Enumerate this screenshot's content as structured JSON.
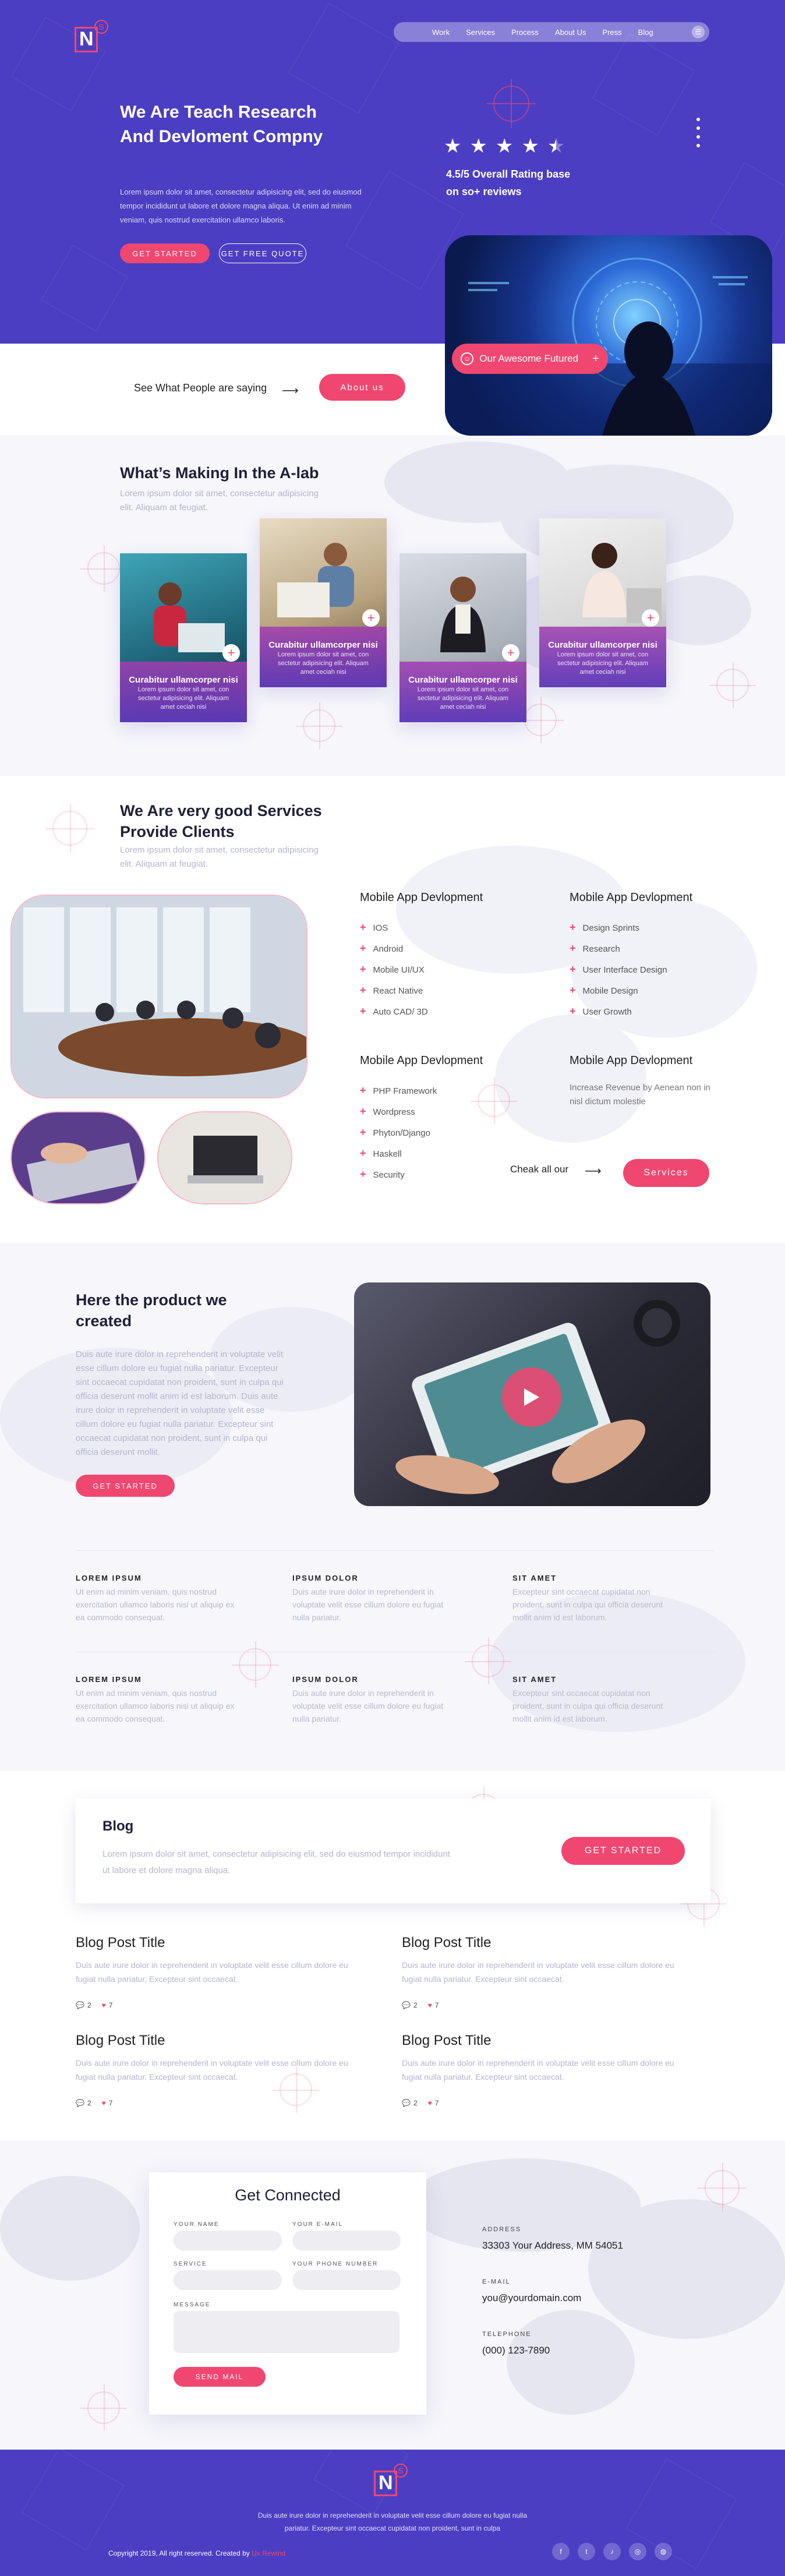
{
  "colors": {
    "brand": "#4b3ec2",
    "accent": "#f04770",
    "muted": "#b3b6cc",
    "section_bg": "#f6f6fb"
  },
  "header": {
    "logo_letter": "N",
    "logo_badge": "S",
    "nav": [
      "Work",
      "Services",
      "Process",
      "About Us",
      "Press",
      "Blog"
    ],
    "menu_icon": "menu-icon"
  },
  "hero": {
    "title": "We Are Teach Research And Devloment Compny",
    "description": "Lorem ipsum dolor sit amet, consectetur adipisicing elit, sed do eiusmod tempor incididunt ut labore et dolore magna aliqua. Ut enim ad minim veniam, quis nostrud exercitation ullamco laboris.",
    "cta_label": "Get Started",
    "quote_label": "Get Free Quote",
    "rating": 4.5,
    "rating_max": 5,
    "rating_text": "4.5/5 Overall Rating base on so+ reviews",
    "featured_label": "Our Awesome Futured",
    "featured_icon": "smile-icon"
  },
  "testimonial": {
    "text": "See What People are saying",
    "button": "About us"
  },
  "lab": {
    "title": "What’s Making In the A-lab",
    "description": "Lorem ipsum dolor sit amet, consectetur adipisicing elit. Aliquam at feugiat.",
    "cards": [
      {
        "title": "Curabitur ullamcorper nisi",
        "description": "Lorem ipsum dolor sit amet, con sectetur adipisicing elit. Aliquam amet ceciah nisi"
      },
      {
        "title": "Curabitur ullamcorper nisi",
        "description": "Lorem ipsum dolor sit amet, con sectetur adipisicing elit. Aliquam amet ceciah nisi"
      },
      {
        "title": "Curabitur ullamcorper nisi",
        "description": "Lorem ipsum dolor sit amet, con sectetur adipisicing elit. Aliquam amet ceciah nisi"
      },
      {
        "title": "Curabitur ullamcorper nisi",
        "description": "Lorem ipsum dolor sit amet, con sectetur adipisicing elit. Aliquam amet ceciah nisi"
      }
    ]
  },
  "services": {
    "title": "We Are very good Services Provide Clients",
    "description": "Lorem ipsum dolor sit amet, consectetur adipisicing elit. Aliquam at feugiat.",
    "columns": [
      {
        "title": "Mobile App Devlopment",
        "items": [
          "IOS",
          "Android",
          "Mobile UI/UX",
          "React Native",
          "Auto CAD/ 3D"
        ]
      },
      {
        "title": "Mobile App Devlopment",
        "items": [
          "Design Sprints",
          "Research",
          "User Interface Design",
          "Mobile Design",
          "User Growth"
        ]
      },
      {
        "title": "Mobile App Devlopment",
        "items": [
          "PHP Framework",
          "Wordpress",
          "Phyton/Django",
          "Haskell",
          "Security"
        ]
      },
      {
        "title": "Mobile App Devlopment",
        "text": "Increase Revenue by Aenean non in nisl dictum molestie"
      }
    ],
    "check_text": "Cheak all our",
    "button": "Services"
  },
  "product": {
    "title": "Here the product we created",
    "description": "Duis aute irure dolor in reprehenderit in voluptate velit esse cillum dolore eu fugiat nulla pariatur. Excepteur sint occaecat cupidatat non proident, sunt in culpa qui officia deserunt mollit anim id est laborum. Duis aute irure dolor in reprehenderit in voluptate velit esse cillum dolore eu fugiat nulla pariatur. Excepteur sint occaecat cupidatat non proident, sunt in culpa qui officia deserunt mollit.",
    "button": "Get Started",
    "features_row1": [
      {
        "label": "LOREM IPSUM",
        "text": "Ut enim ad minim veniam, quis nostrud exercitation ullamco laboris nisi ut aliquip ex ea commodo consequat."
      },
      {
        "label": "IPSUM DOLOR",
        "text": "Duis aute irure dolor in reprehenderit in voluptate velit esse cillum dolore eu fugiat nulla pariatur."
      },
      {
        "label": "SIT AMET",
        "text": "Excepteur sint occaecat cupidatat non proident, sunt in culpa qui officia deserunt mollit anim id est laborum."
      }
    ],
    "features_row2": [
      {
        "label": "LOREM IPSUM",
        "text": "Ut enim ad minim veniam, quis nostrud exercitation ullamco laboris nisi ut aliquip ex ea commodo consequat."
      },
      {
        "label": "IPSUM DOLOR",
        "text": "Duis aute irure dolor in reprehenderit in voluptate velit esse cillum dolore eu fugiat nulla pariatur."
      },
      {
        "label": "SIT AMET",
        "text": "Excepteur sint occaecat cupidatat non proident, sunt in culpa qui officia deserunt mollit anim id est laborum."
      }
    ]
  },
  "blog": {
    "title": "Blog",
    "description": "Lorem ipsum dolor sit amet, consectetur adipisicing elit, sed do eiusmod tempor incididunt ut labore et dolore magna aliqua.",
    "button": "Get Started",
    "posts": [
      {
        "title": "Blog Post Title",
        "description": "Duis aute irure dolor in reprehenderit in voluptate velit esse cillum dolore eu fugiat nulla pariatur. Excepteur sint occaecat.",
        "comments": "2",
        "likes": "7"
      },
      {
        "title": "Blog Post Title",
        "description": "Duis aute irure dolor in reprehenderit in voluptate velit esse cillum dolore eu fugiat nulla pariatur. Excepteur sint occaecat.",
        "comments": "2",
        "likes": "7"
      },
      {
        "title": "Blog Post Title",
        "description": "Duis aute irure dolor in reprehenderit in voluptate velit esse cillum dolore eu fugiat nulla pariatur. Excepteur sint occaecat.",
        "comments": "2",
        "likes": "7"
      },
      {
        "title": "Blog Post Title",
        "description": "Duis aute irure dolor in reprehenderit in voluptate velit esse cillum dolore eu fugiat nulla pariatur. Excepteur sint occaecat.",
        "comments": "2",
        "likes": "7"
      }
    ]
  },
  "contact": {
    "title": "Get Connected",
    "fields": {
      "name": "YOUR NAME",
      "email": "YOUR E-MAIL",
      "service": "SERVICE",
      "phone": "YOUR PHONE NUMBER",
      "message": "MESSAGE"
    },
    "send": "Send Mail",
    "address_label": "ADDRESS",
    "address": "33303 Your Address, MM 54051",
    "email_label": "E-MAIL",
    "email": "you@yourdomain.com",
    "phone_label": "TELEPHONE",
    "phone": "(000) 123-7890"
  },
  "footer": {
    "description": "Duis aute irure dolor in reprehenderit in voluptate velit esse cillum dolore eu fugiat nulla pariatur. Excepteur sint occaecat cupidatat non proident, sunt in culpa",
    "copyright": "Copyright 2019, All right reserved. Created by",
    "brand": "Ux Rewind",
    "social": [
      "facebook-icon",
      "twitter-icon",
      "tiktok-icon",
      "instagram-icon",
      "dribbble-icon"
    ]
  }
}
